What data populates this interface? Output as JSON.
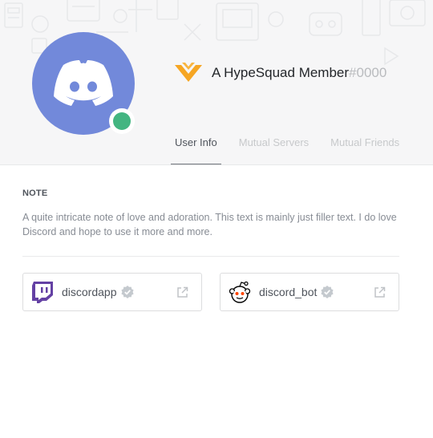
{
  "profile": {
    "username": "A HypeSquad Member",
    "discriminator": "#0000",
    "status_color": "#43b581",
    "avatar_color": "#7289da",
    "badge_icon": "hypesquad-badge-icon"
  },
  "tabs": [
    {
      "label": "User Info",
      "active": true
    },
    {
      "label": "Mutual Servers",
      "active": false
    },
    {
      "label": "Mutual Friends",
      "active": false
    }
  ],
  "note": {
    "title": "NOTE",
    "text": "A quite intricate note of love and adoration. This text is mainly just filler text. I do love Discord and hope to use it more and more."
  },
  "connected_accounts": [
    {
      "service": "twitch",
      "icon": "twitch-icon",
      "name": "discordapp",
      "verified": true
    },
    {
      "service": "reddit",
      "icon": "reddit-icon",
      "name": "discord_bot",
      "verified": true
    }
  ]
}
